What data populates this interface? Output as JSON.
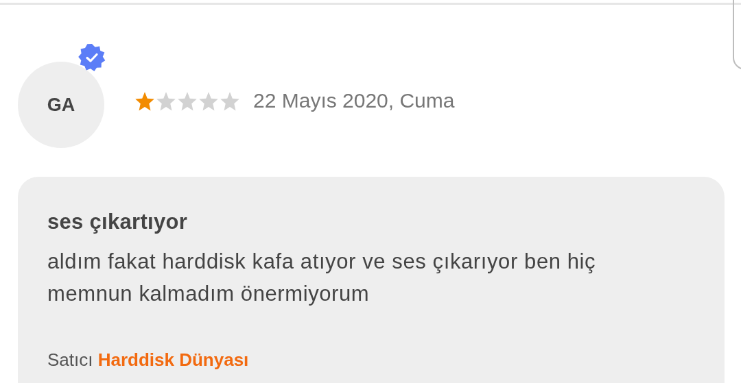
{
  "review": {
    "avatar_initials": "GA",
    "verified": true,
    "stars": 1,
    "date": "22 Mayıs 2020, Cuma",
    "title": "ses çıkartıyor",
    "body": "aldım fakat harddisk kafa atıyor ve ses çıkarıyor ben hiç memnun kalmadım önermiyorum",
    "seller_label": "Satıcı",
    "seller_name": "Harddisk Dünyası"
  }
}
